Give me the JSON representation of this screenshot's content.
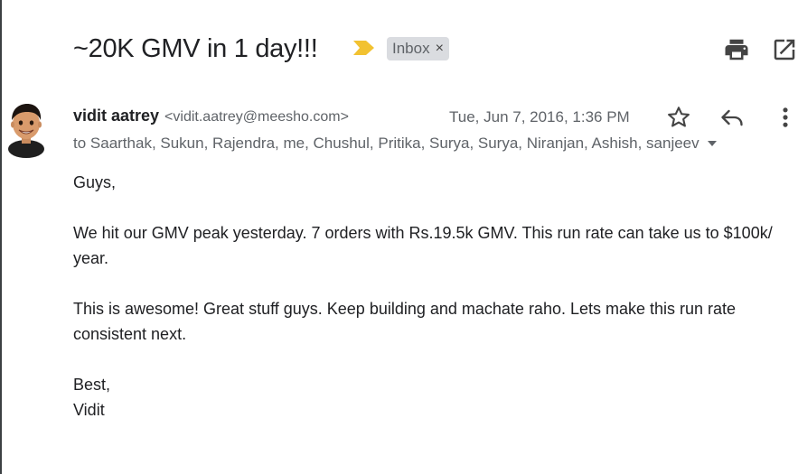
{
  "email": {
    "subject": "~20K GMV in 1 day!!!",
    "label": "Inbox",
    "label_close": "×",
    "sender": {
      "name": "vidit aatrey",
      "email": "<vidit.aatrey@meesho.com>"
    },
    "date": "Tue, Jun 7, 2016, 1:36 PM",
    "recipients": "to Saarthak, Sukun, Rajendra, me, Chushul, Pritika, Surya, Surya, Niranjan, Ashish, sanjeev",
    "body": {
      "greeting": "Guys,",
      "paragraph1": "We hit our GMV peak yesterday. 7 orders with Rs.19.5k GMV. This run rate can take us to $100k/ year.",
      "paragraph2": "This is awesome! Great stuff guys. Keep building and machate raho. Lets make this run rate consistent next.",
      "signoff": "Best,",
      "signature": "Vidit"
    }
  },
  "icons": {
    "important": "important-marker-icon",
    "print": "print-icon",
    "popout": "open-in-new-window-icon",
    "star": "star-icon",
    "reply": "reply-icon",
    "more": "more-vertical-icon",
    "recipients_caret": "caret-down-icon",
    "avatar": "avatar"
  },
  "colors": {
    "important_marker": "#f2c231",
    "chip_bg": "#dadce0",
    "secondary_text": "#5f6368",
    "primary_text": "#202124"
  }
}
